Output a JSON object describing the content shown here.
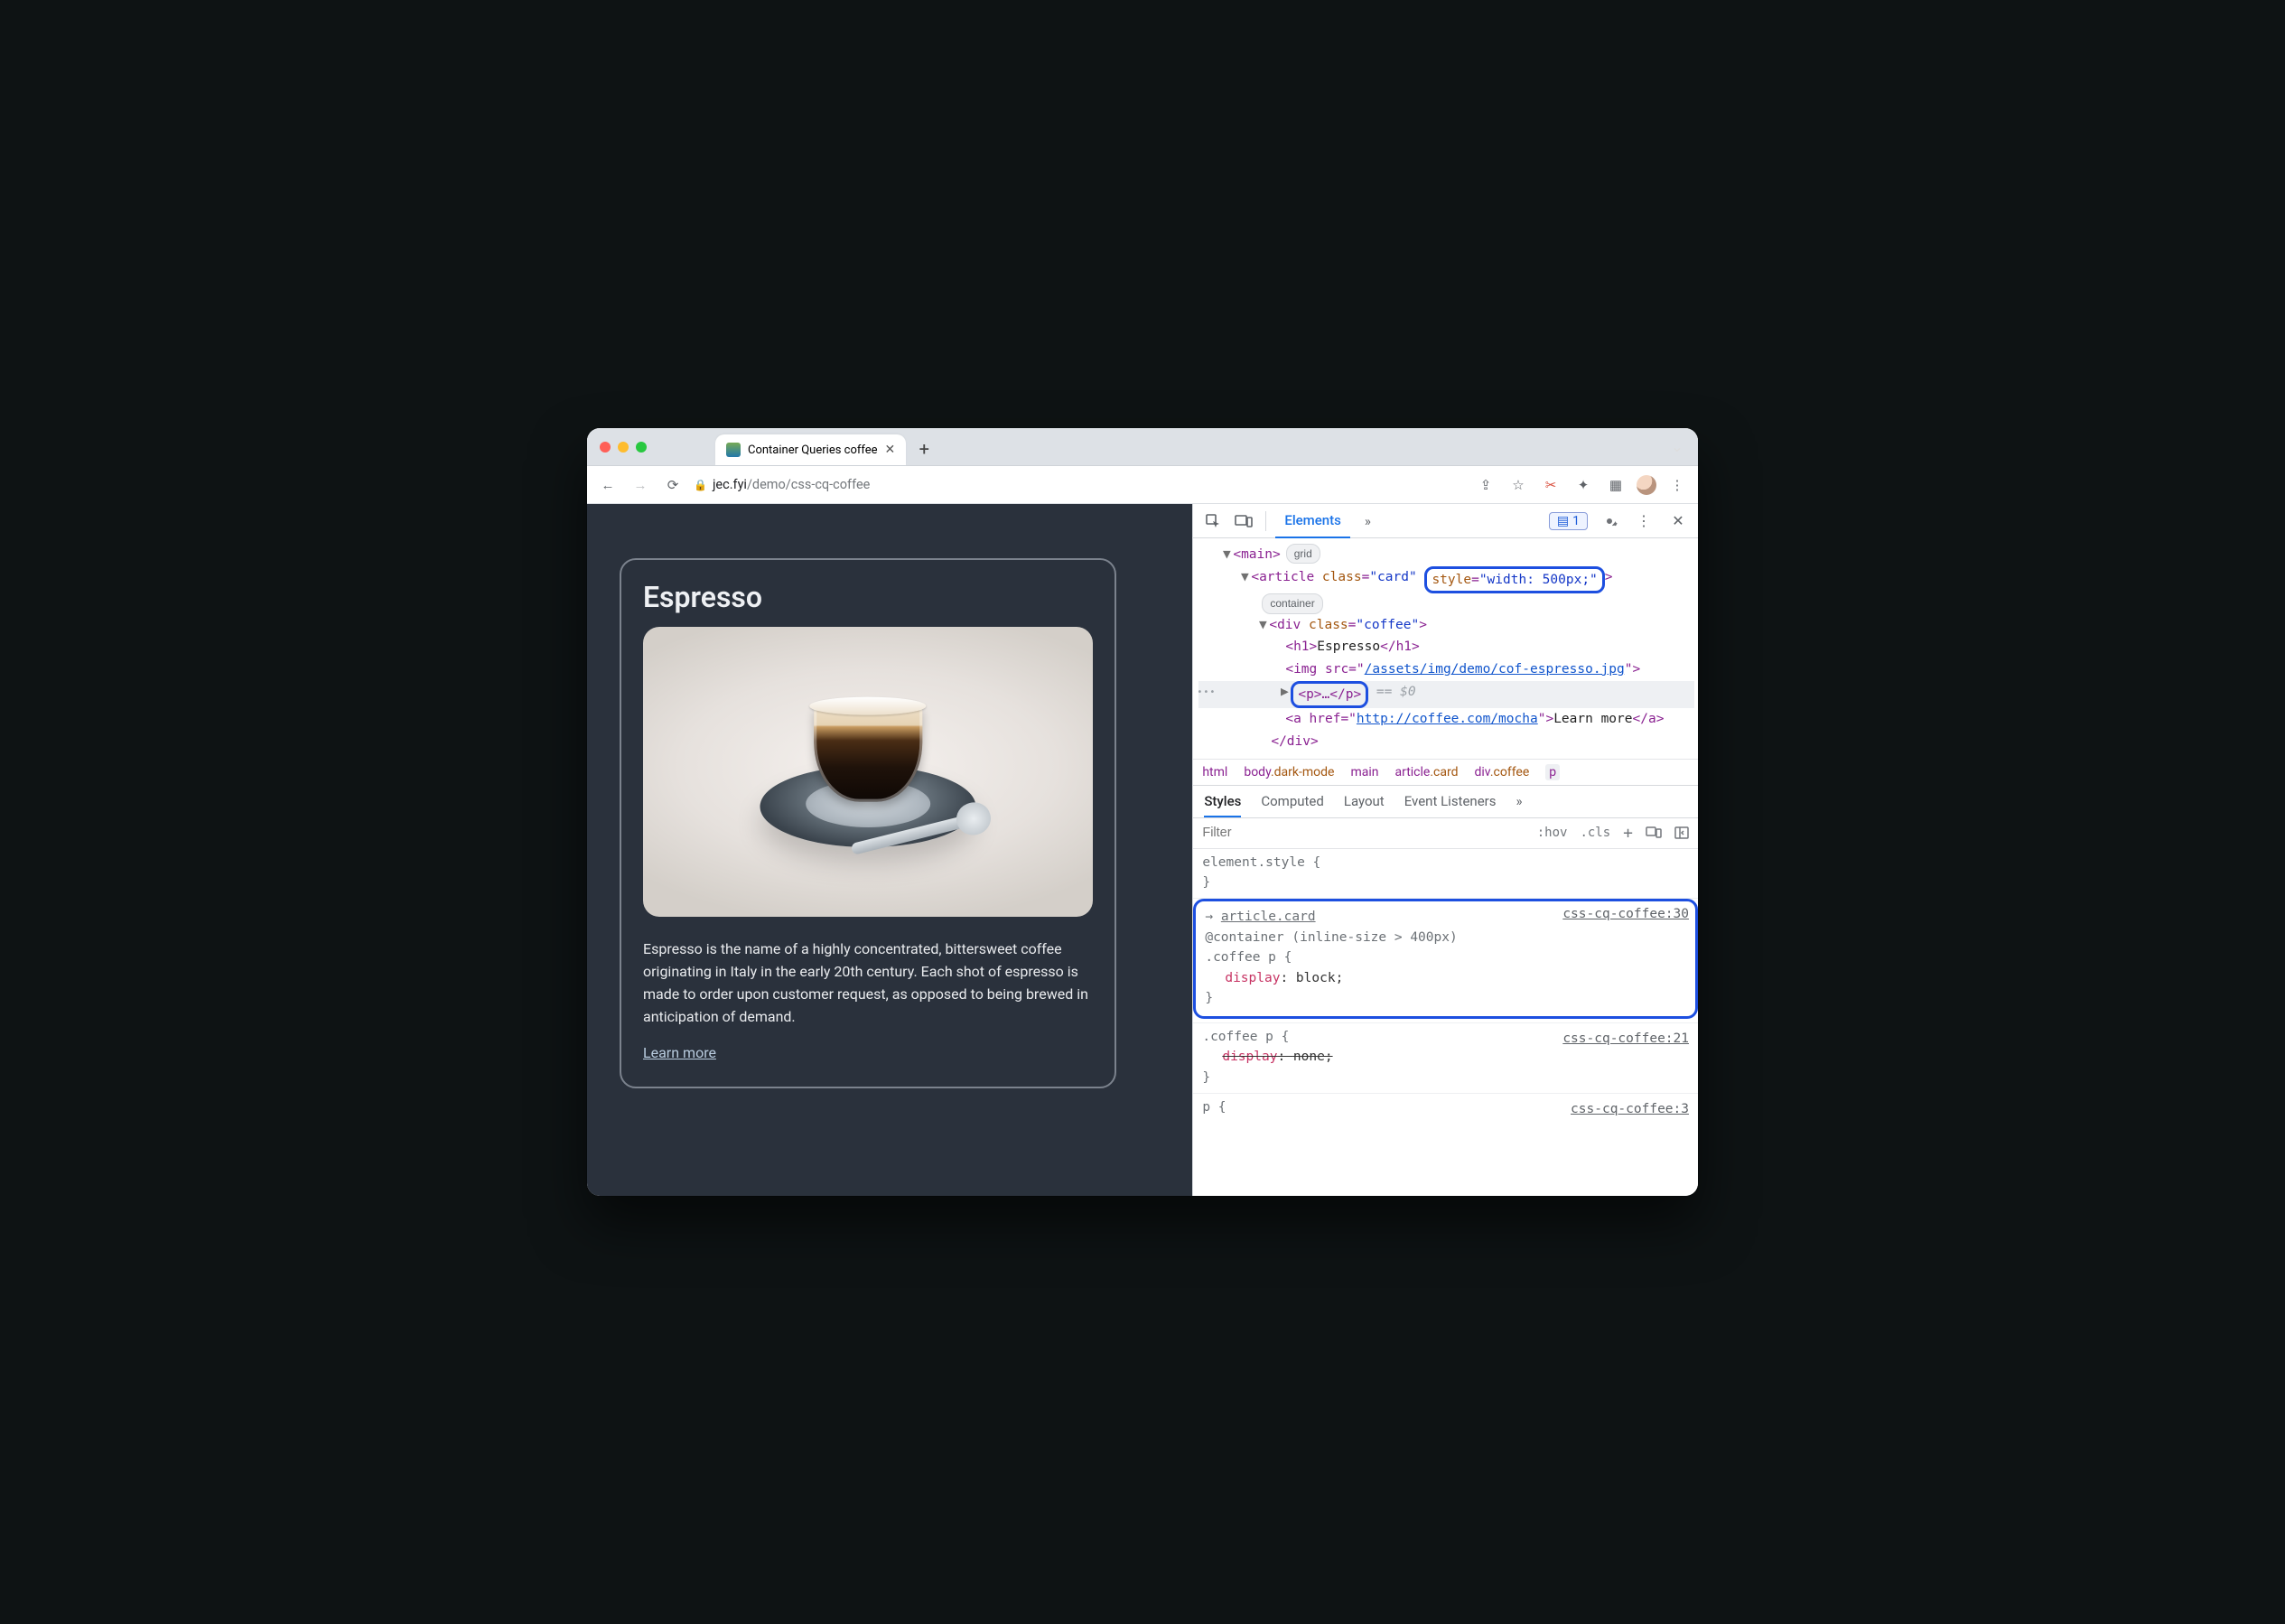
{
  "browser": {
    "tab_title": "Container Queries coffee",
    "url_host": "jec.fyi",
    "url_path": "/demo/css-cq-coffee",
    "new_tab_glyph": "+",
    "chevron_glyph": "⌄",
    "nav": {
      "back": "←",
      "forward": "→",
      "reload": "⟳"
    },
    "actions": {
      "share": "⇪",
      "star": "☆",
      "cut": "✂",
      "ext": "✦",
      "tabswitch": "▦",
      "menu": "⋮"
    }
  },
  "page": {
    "heading": "Espresso",
    "paragraph": "Espresso is the name of a highly concentrated, bittersweet coffee originating in Italy in the early 20th century. Each shot of espresso is made to order upon customer request, as opposed to being brewed in anticipation of demand.",
    "link_label": "Learn more"
  },
  "devtools": {
    "tabs": {
      "elements": "Elements",
      "more": "»"
    },
    "issues_count": "1",
    "tree": {
      "main_open": "<main>",
      "main_badge": "grid",
      "article_open_1": "<article ",
      "article_class": "class",
      "article_class_val": "\"card\"",
      "article_style": "style",
      "article_style_val": "\"width: 500px;\"",
      "article_open_2": ">",
      "article_badge": "container",
      "div_open": "<div class=\"coffee\">",
      "h1": "<h1>Espresso</h1>",
      "img_1": "<img src=\"",
      "img_src": "/assets/img/demo/cof-espresso.jpg",
      "img_2": "\">",
      "p_collapsed": "<p>…</p>",
      "eq0": "== $0",
      "a_1": "<a href=\"",
      "a_href": "http://coffee.com/mocha",
      "a_2": "\">Learn more</a>",
      "div_close": "</div>"
    },
    "crumb": {
      "c0": "html",
      "c1a": "body",
      "c1b": ".dark-mode",
      "c2": "main",
      "c3a": "article",
      "c3b": ".card",
      "c4a": "div",
      "c4b": ".coffee",
      "c5": "p"
    },
    "subtabs": {
      "styles": "Styles",
      "computed": "Computed",
      "layout": "Layout",
      "listeners": "Event Listeners",
      "more": "»"
    },
    "filter_placeholder": "Filter",
    "filter_hov": ":hov",
    "filter_cls": ".cls",
    "filter_plus": "+",
    "rules": {
      "r0_sel": "element.style {",
      "r0_close": "}",
      "r1_src": "css-cq-coffee:30",
      "r1_inherit_arrow": "→ ",
      "r1_inherit": "article.card",
      "r1_at": "@container (inline-size > 400px)",
      "r1_sel": ".coffee p {",
      "r1_prop": "display",
      "r1_val": "block;",
      "r1_close": "}",
      "r2_src": "css-cq-coffee:21",
      "r2_sel": ".coffee p {",
      "r2_prop": "display",
      "r2_val": "none;",
      "r2_close": "}",
      "r3_src": "css-cq-coffee:3",
      "r3_sel": "p {"
    }
  }
}
